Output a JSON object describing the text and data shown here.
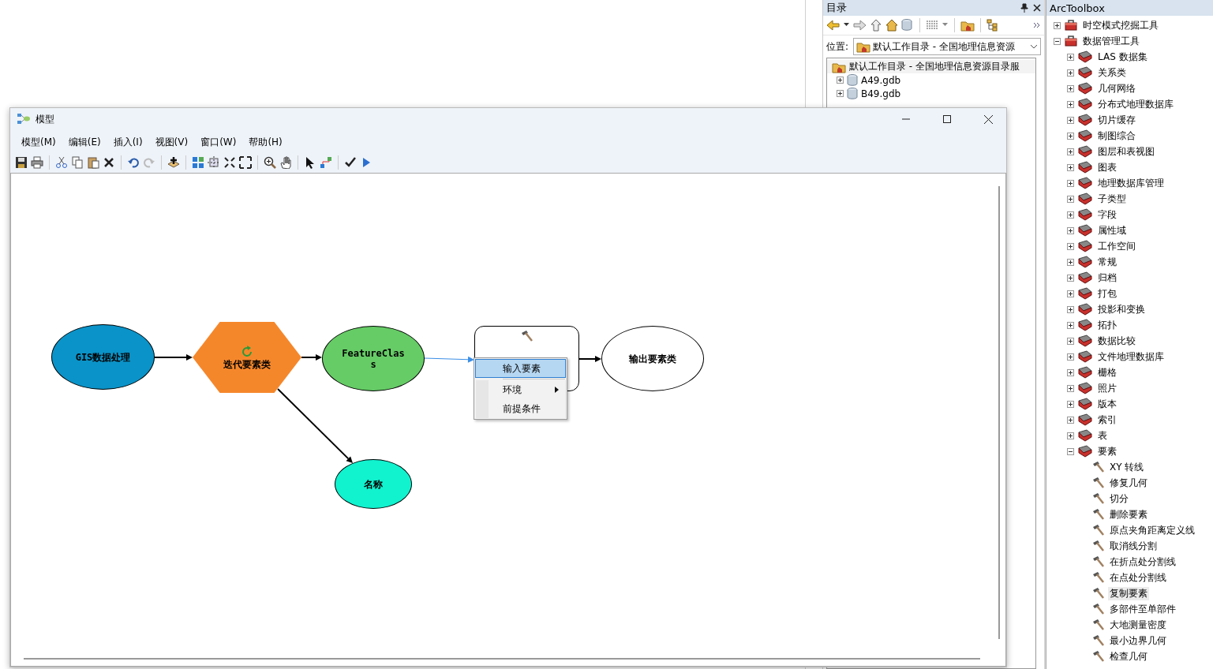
{
  "catalog": {
    "title": "目录",
    "location_label": "位置:",
    "location_value": "默认工作目录 - 全国地理信息资源",
    "tree": {
      "label": "默认工作目录 - 全国地理信息资源目录服",
      "children": [
        {
          "label": "A49.gdb",
          "expanded": false
        },
        {
          "label": "B49.gdb",
          "expanded": false
        }
      ]
    }
  },
  "arctoolbox": {
    "title": "ArcToolbox",
    "tree": [
      {
        "kind": "toolbox",
        "label": "时空模式挖掘工具",
        "expanded": false
      },
      {
        "kind": "toolbox",
        "label": "数据管理工具",
        "expanded": true,
        "children": [
          {
            "kind": "toolset",
            "label": "LAS 数据集",
            "expanded": false
          },
          {
            "kind": "toolset",
            "label": "关系类",
            "expanded": false
          },
          {
            "kind": "toolset",
            "label": "几何网络",
            "expanded": false
          },
          {
            "kind": "toolset",
            "label": "分布式地理数据库",
            "expanded": false
          },
          {
            "kind": "toolset",
            "label": "切片缓存",
            "expanded": false
          },
          {
            "kind": "toolset",
            "label": "制图综合",
            "expanded": false
          },
          {
            "kind": "toolset",
            "label": "图层和表视图",
            "expanded": false
          },
          {
            "kind": "toolset",
            "label": "图表",
            "expanded": false
          },
          {
            "kind": "toolset",
            "label": "地理数据库管理",
            "expanded": false
          },
          {
            "kind": "toolset",
            "label": "子类型",
            "expanded": false
          },
          {
            "kind": "toolset",
            "label": "字段",
            "expanded": false
          },
          {
            "kind": "toolset",
            "label": "属性域",
            "expanded": false
          },
          {
            "kind": "toolset",
            "label": "工作空间",
            "expanded": false
          },
          {
            "kind": "toolset",
            "label": "常规",
            "expanded": false
          },
          {
            "kind": "toolset",
            "label": "归档",
            "expanded": false
          },
          {
            "kind": "toolset",
            "label": "打包",
            "expanded": false
          },
          {
            "kind": "toolset",
            "label": "投影和变换",
            "expanded": false
          },
          {
            "kind": "toolset",
            "label": "拓扑",
            "expanded": false
          },
          {
            "kind": "toolset",
            "label": "数据比较",
            "expanded": false
          },
          {
            "kind": "toolset",
            "label": "文件地理数据库",
            "expanded": false
          },
          {
            "kind": "toolset",
            "label": "栅格",
            "expanded": false
          },
          {
            "kind": "toolset",
            "label": "照片",
            "expanded": false
          },
          {
            "kind": "toolset",
            "label": "版本",
            "expanded": false
          },
          {
            "kind": "toolset",
            "label": "索引",
            "expanded": false
          },
          {
            "kind": "toolset",
            "label": "表",
            "expanded": false
          },
          {
            "kind": "toolset",
            "label": "要素",
            "expanded": true,
            "children": [
              {
                "kind": "tool",
                "label": "XY 转线",
                "selected": false
              },
              {
                "kind": "tool",
                "label": "修复几何",
                "selected": false
              },
              {
                "kind": "tool",
                "label": "切分",
                "selected": false
              },
              {
                "kind": "tool",
                "label": "删除要素",
                "selected": false
              },
              {
                "kind": "tool",
                "label": "原点夹角距离定义线",
                "selected": false
              },
              {
                "kind": "tool",
                "label": "取消线分割",
                "selected": false
              },
              {
                "kind": "tool",
                "label": "在折点处分割线",
                "selected": false
              },
              {
                "kind": "tool",
                "label": "在点处分割线",
                "selected": false
              },
              {
                "kind": "tool",
                "label": "复制要素",
                "selected": true
              },
              {
                "kind": "tool",
                "label": "多部件至单部件",
                "selected": false
              },
              {
                "kind": "tool",
                "label": "大地测量密度",
                "selected": false
              },
              {
                "kind": "tool",
                "label": "最小边界几何",
                "selected": false
              },
              {
                "kind": "tool",
                "label": "检查几何",
                "selected": false
              }
            ]
          }
        ]
      }
    ]
  },
  "model_window": {
    "title": "模型",
    "menu": [
      "模型(M)",
      "编辑(E)",
      "插入(I)",
      "视图(V)",
      "窗口(W)",
      "帮助(H)"
    ],
    "diagram": {
      "nodes": [
        {
          "kind": "data",
          "label": "GIS数据处理",
          "color": "#0a93c8"
        },
        {
          "kind": "iterator",
          "label": "迭代要素类",
          "color": "#f5872b"
        },
        {
          "kind": "data",
          "label": "FeatureClass",
          "color": "#66cc66"
        },
        {
          "kind": "data",
          "label": "名称",
          "color": "#11f2cf"
        },
        {
          "kind": "tool"
        },
        {
          "kind": "data",
          "label": "输出要素类",
          "color": "#ffffff"
        }
      ],
      "connectors": [
        {
          "selected": false
        },
        {
          "selected": false
        },
        {
          "selected": true
        },
        {
          "selected": false
        },
        {
          "selected": false
        }
      ],
      "context_menu": [
        {
          "label": "输入要素",
          "selected": true,
          "submenu": false
        },
        {
          "label": "环境",
          "selected": false,
          "submenu": true
        },
        {
          "label": "前提条件",
          "selected": false,
          "submenu": false
        }
      ]
    }
  }
}
